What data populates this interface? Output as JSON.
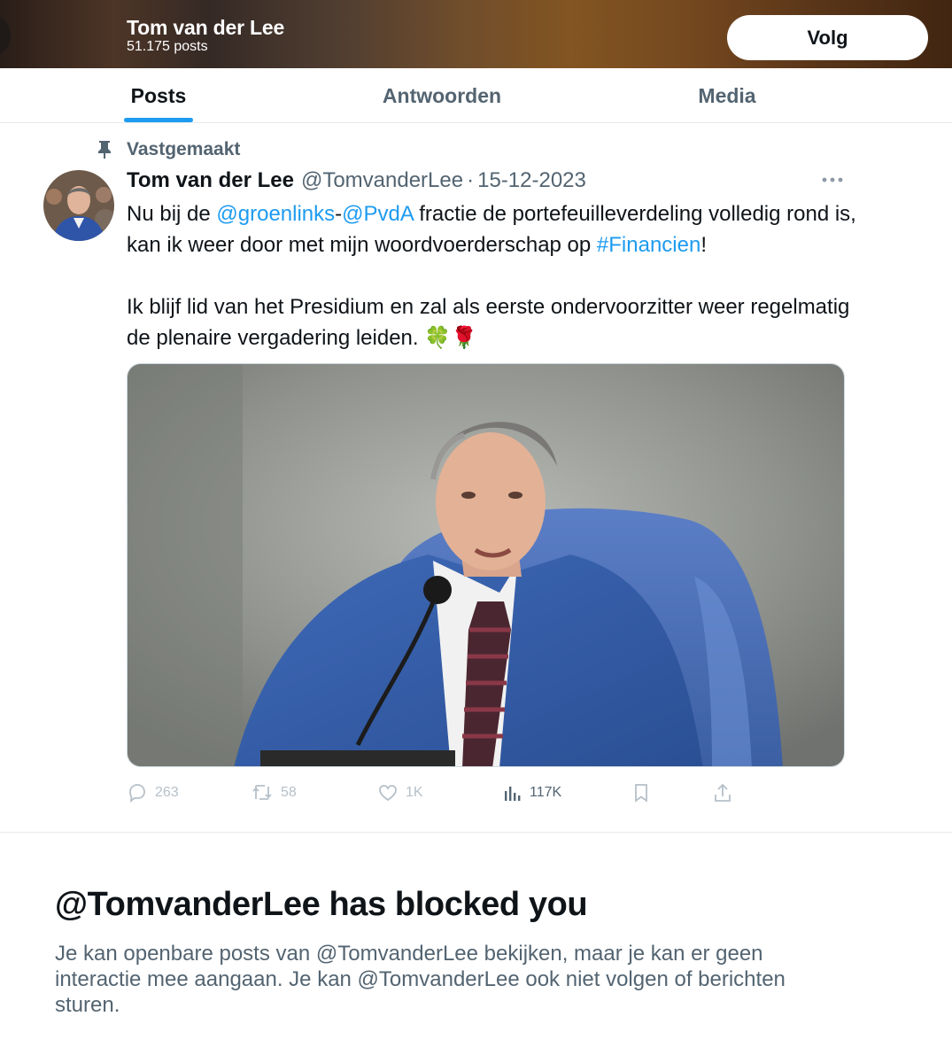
{
  "header": {
    "name": "Tom van der Lee",
    "posts_count": "51.175 posts",
    "follow_label": "Volg"
  },
  "tabs": [
    {
      "label": "Posts",
      "active": true
    },
    {
      "label": "Antwoorden",
      "active": false
    },
    {
      "label": "Media",
      "active": false
    }
  ],
  "tweet": {
    "pinned_label": "Vastgemaakt",
    "author_name": "Tom van der Lee",
    "author_handle": "@TomvanderLee",
    "separator": "·",
    "date": "15-12-2023",
    "text_parts": {
      "p1": "Nu bij de ",
      "mention1": "@groenlinks",
      "p2": "-",
      "mention2": "@PvdA",
      "p3": " fractie de portefeuilleverdeling volledig rond is, kan ik weer door met mijn woordvoerderschap op ",
      "hashtag": "#Financien",
      "p4": "!\n\nIk blijf lid van het Presidium en zal als eerste ondervoorzitter weer regelmatig de plenaire vergadering leiden. 🍀🌹"
    },
    "actions": {
      "replies": "263",
      "reposts": "58",
      "likes": "1K",
      "views": "117K"
    }
  },
  "blocked": {
    "title": "@TomvanderLee has blocked you",
    "body": "Je kan openbare posts van @TomvanderLee bekijken, maar je kan er geen interactie mee aangaan. Je kan @TomvanderLee ook niet volgen of berichten sturen."
  },
  "colors": {
    "accent": "#1d9bf0",
    "text_primary": "#0f1419",
    "text_secondary": "#536471",
    "disabled_action": "#b6c0c8"
  },
  "icons": [
    "back-icon",
    "pin-icon",
    "more-icon",
    "reply-icon",
    "repost-icon",
    "like-icon",
    "views-icon",
    "bookmark-icon",
    "share-icon"
  ]
}
